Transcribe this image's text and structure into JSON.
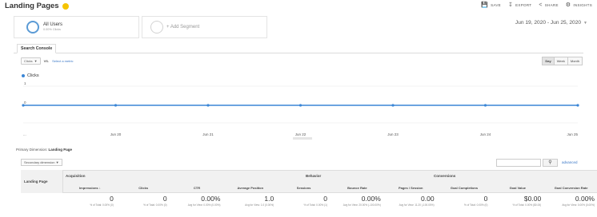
{
  "header": {
    "title": "Landing Pages",
    "save": "SAVE",
    "export": "EXPORT",
    "share": "SHARE",
    "insights": "INSIGHTS"
  },
  "segments": {
    "first_title": "All Users",
    "first_sub": "0.00% Clicks",
    "add_label": "+ Add Segment"
  },
  "date_range": "Jun 19, 2020 - Jun 25, 2020",
  "tabs": [
    "Search Console"
  ],
  "metric_controls": {
    "metric": "Clicks",
    "vs": "VS.",
    "select_metric": "Select a metric",
    "periods": [
      "Day",
      "Week",
      "Month"
    ],
    "active_period": "Day"
  },
  "chart_data": {
    "type": "line",
    "series": [
      {
        "name": "Clicks",
        "values": [
          0,
          0,
          0,
          0,
          0,
          0,
          0
        ]
      }
    ],
    "y_ticks": [
      "1",
      "0"
    ],
    "x_ticks": [
      "...",
      "Jun 20",
      "Jun 21",
      "Jun 22",
      "Jun 23",
      "Jun 24",
      "Jun 25"
    ],
    "ylim": [
      0,
      1
    ],
    "grid": true,
    "colors": {
      "line": "#3b86d6"
    }
  },
  "primary_dimension": {
    "label": "Primary Dimension:",
    "value": "Landing Page"
  },
  "secondary_dimension": "Secondary dimension",
  "advanced": "advanced",
  "table": {
    "first_column": "Landing Page",
    "groups": [
      "Acquisition",
      "Behavior",
      "Conversions"
    ],
    "columns": [
      "Impressions",
      "Clicks",
      "CTR",
      "Average Position",
      "Sessions",
      "Bounce Rate",
      "Pages / Session",
      "Goal Completions",
      "Goal Value",
      "Goal Conversion Rate"
    ],
    "totals": [
      {
        "value": "0",
        "sub": "% of Total: 0.00% (0)"
      },
      {
        "value": "0",
        "sub": "% of Total: 0.00% (0)"
      },
      {
        "value": "0.00%",
        "sub": "Avg for View: 0.00% (0.00%)"
      },
      {
        "value": "1.0",
        "sub": "Avg for View: 1.0 (0.00%)"
      },
      {
        "value": "0",
        "sub": "% of Total: 0.00% (1)"
      },
      {
        "value": "0.00%",
        "sub": "Avg for View: 20.00% (-100.00%)"
      },
      {
        "value": "0.00",
        "sub": "Avg for View: 11.20 (-100.00%)"
      },
      {
        "value": "0",
        "sub": "% of Total: 0.00% (0)"
      },
      {
        "value": "$0.00",
        "sub": "% of Total: 0.00% ($0.00)"
      },
      {
        "value": "0.00%",
        "sub": "Avg for View: 0.00% (0.00%)"
      }
    ]
  }
}
